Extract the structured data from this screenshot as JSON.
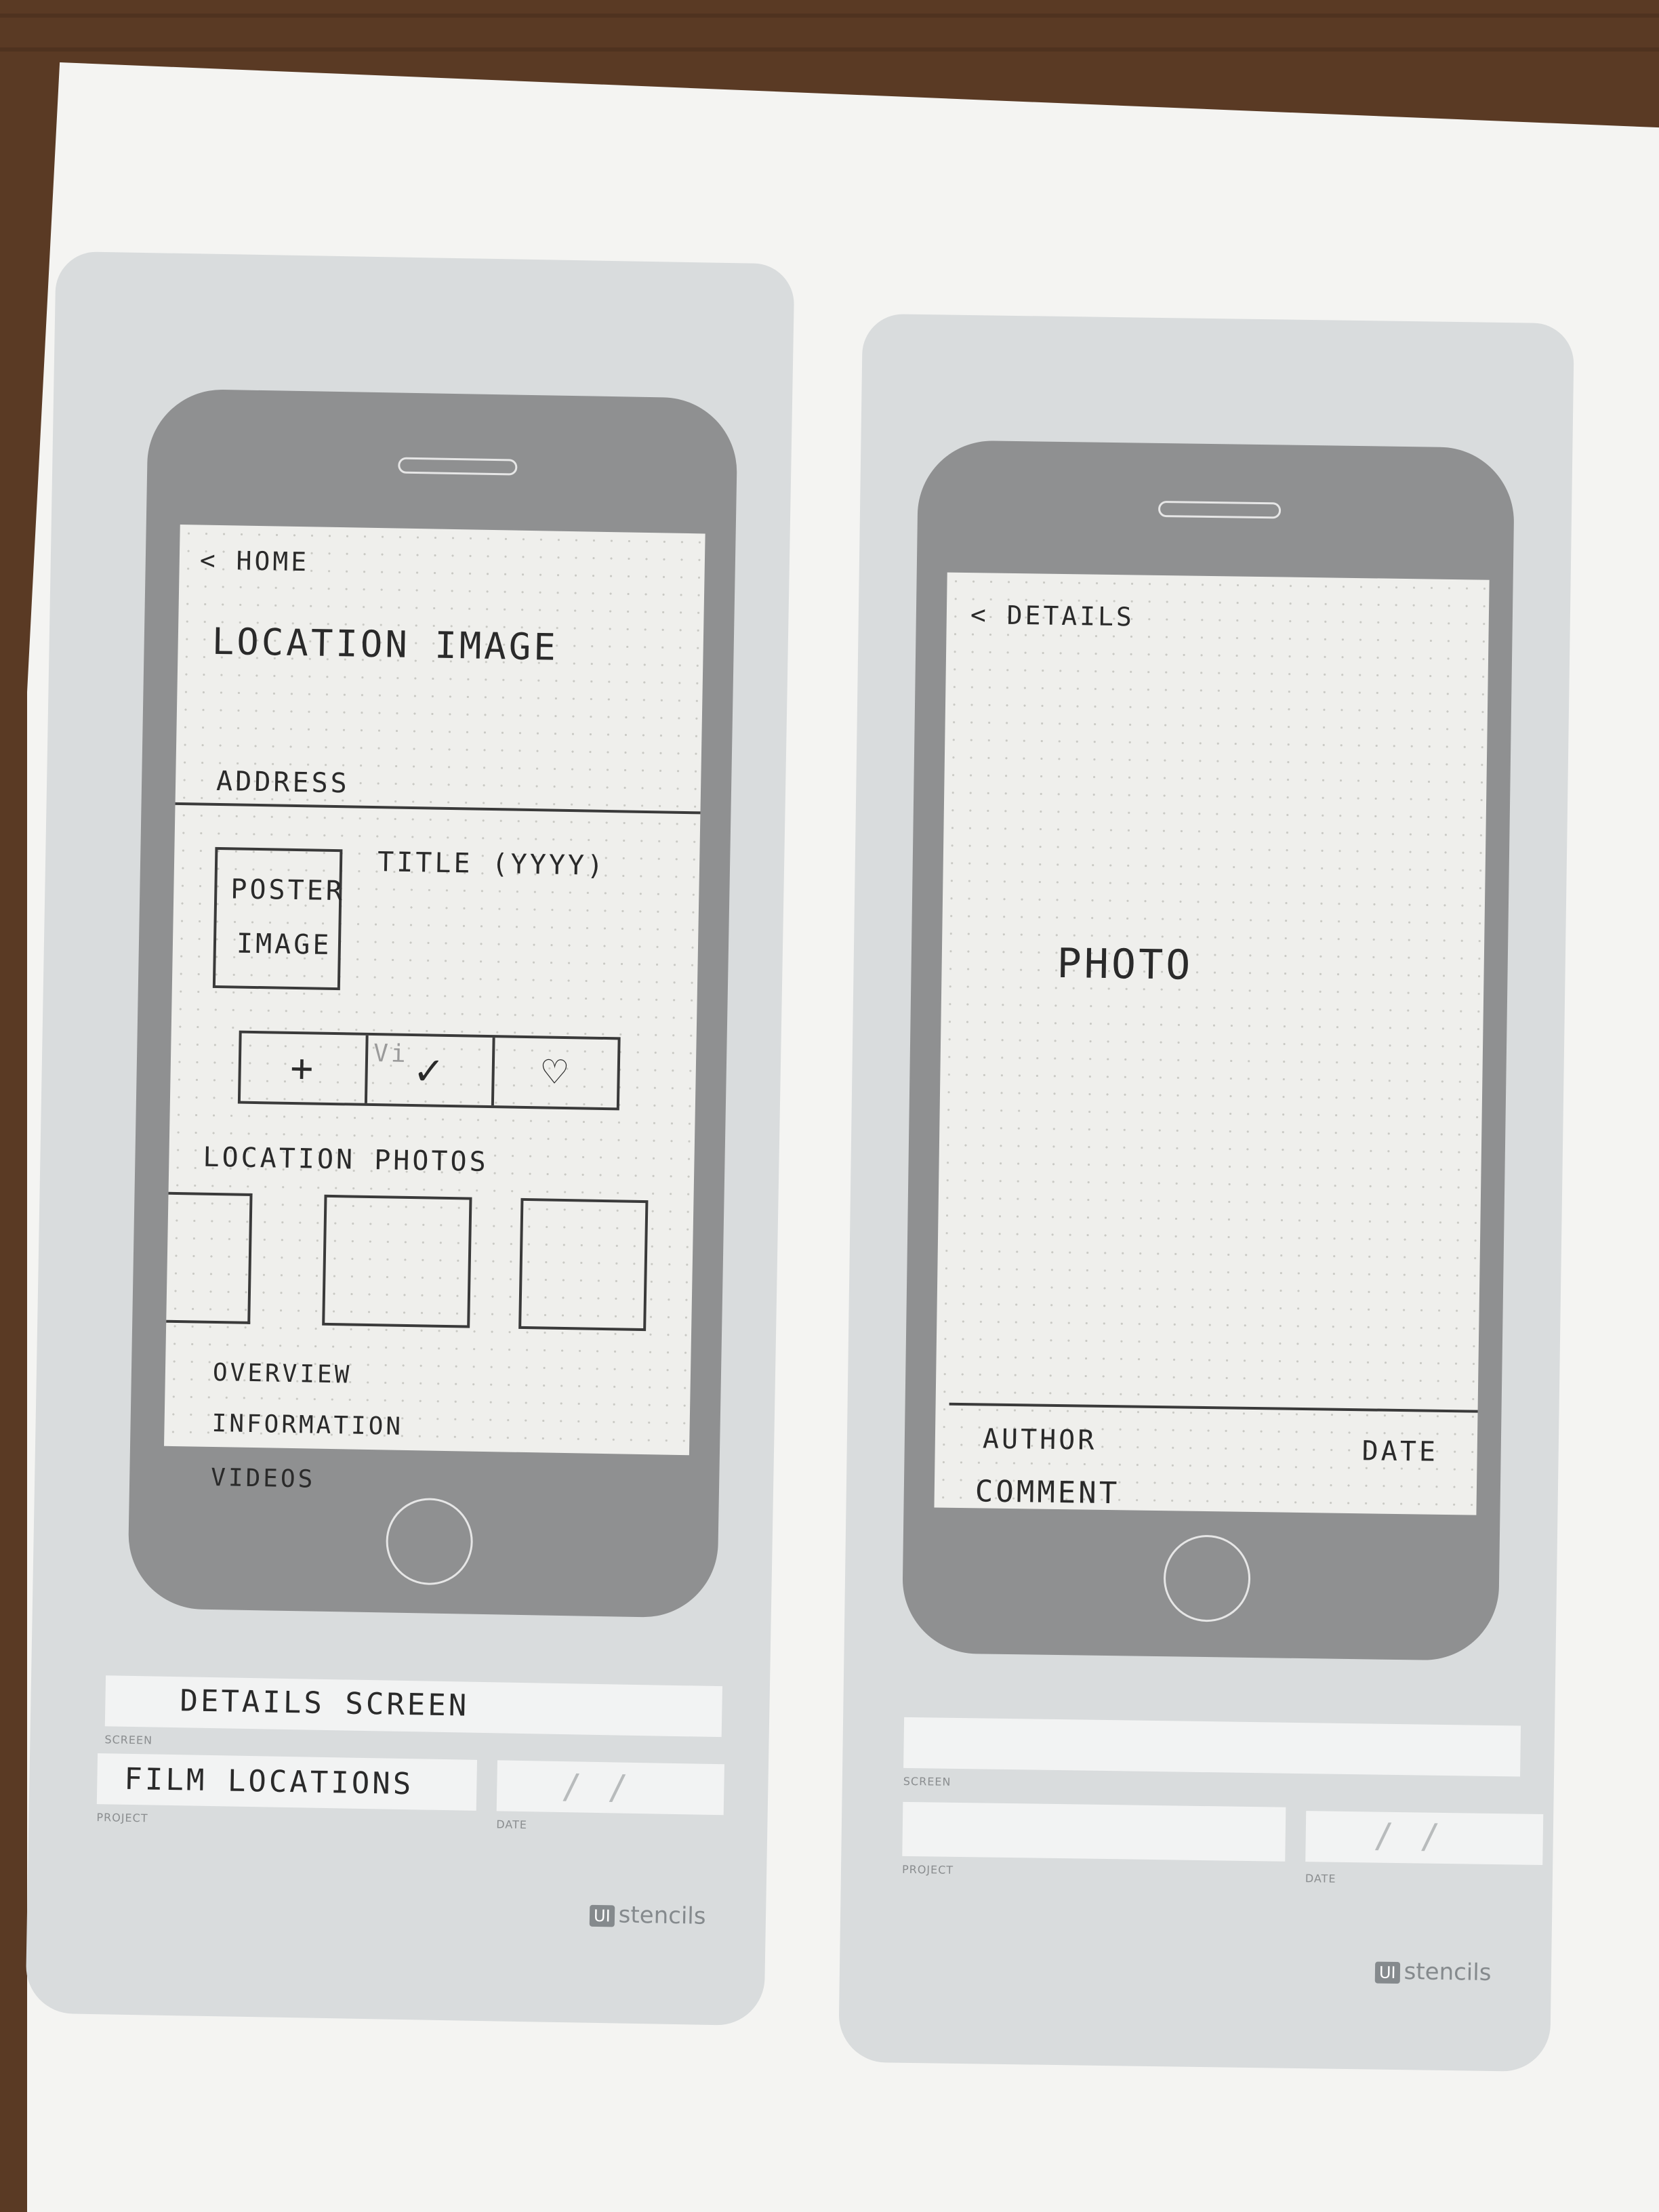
{
  "details_screen": {
    "back_label": "< HOME",
    "header_image_label": "LOCATION   IMAGE",
    "address_label": "ADDRESS",
    "poster_label_line1": "POSTER",
    "poster_label_line2": "IMAGE",
    "title_label": "TITLE  (YYYY)",
    "actions": {
      "add_glyph": "+",
      "visited_glyph": "✓",
      "visited_faint_text": "Vi",
      "favorite_glyph": "♡"
    },
    "location_photos_label": "LOCATION  PHOTOS",
    "nav_links": [
      "OVERVIEW",
      "INFORMATION",
      "VIDEOS"
    ]
  },
  "details_form": {
    "screen_value": "DETAILS    SCREEN",
    "screen_caption": "SCREEN",
    "project_value": "FILM  LOCATIONS",
    "project_caption": "PROJECT",
    "date_caption": "DATE",
    "date_value": "/   /"
  },
  "photo_screen": {
    "back_label": "< DETAILS",
    "photo_label": "PHOTO",
    "author_label": "AUTHOR",
    "date_label": "DATE",
    "comment_label": "COMMENT"
  },
  "photo_form": {
    "screen_caption": "SCREEN",
    "project_caption": "PROJECT",
    "date_caption": "DATE",
    "date_value": "/   /"
  },
  "brand": {
    "badge": "UI",
    "name": "stencils"
  }
}
